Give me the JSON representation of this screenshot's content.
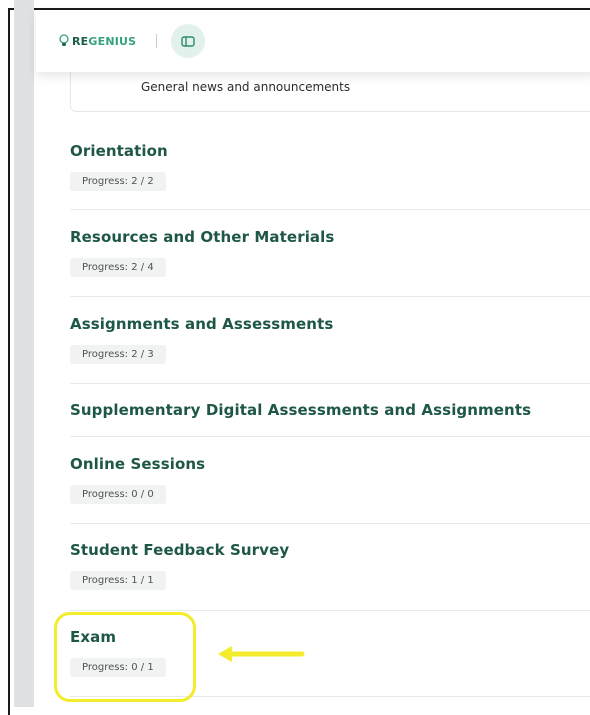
{
  "header": {
    "logo_prefix": "RE",
    "logo_suffix": "GENIUS",
    "brand_dark": "#1b5e44",
    "brand_light": "#36a27e",
    "toggle_icon": "sidebar-toggle-icon"
  },
  "announcement": {
    "text": "General news and announcements"
  },
  "sections": [
    {
      "title": "Orientation",
      "progress": "Progress: 2 / 2"
    },
    {
      "title": "Resources and Other Materials",
      "progress": "Progress: 2 / 4"
    },
    {
      "title": "Assignments and Assessments",
      "progress": "Progress: 2 / 3"
    },
    {
      "title": "Supplementary Digital Assessments and Assignments"
    },
    {
      "title": "Online Sessions",
      "progress": "Progress: 0 / 0"
    },
    {
      "title": "Student Feedback Survey",
      "progress": "Progress: 1 / 1"
    },
    {
      "title": "Exam",
      "progress": "Progress: 0 / 1"
    }
  ],
  "annotations": {
    "highlight_color": "#f2ec2a",
    "highlight_target": "Exam",
    "arrow_icon": "left-arrow-icon"
  }
}
